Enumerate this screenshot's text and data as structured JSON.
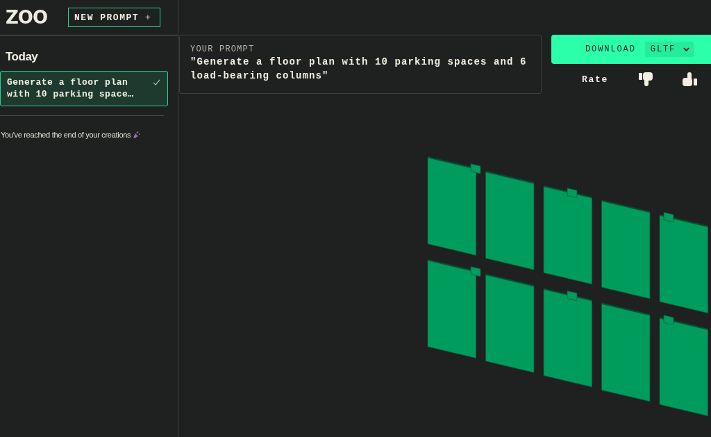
{
  "header": {
    "logo": "ZOO",
    "new_prompt_button": {
      "label": "NEW PROMPT",
      "symbol": "+"
    }
  },
  "sidebar": {
    "section_title": "Today",
    "items": [
      {
        "label": "Generate a floor plan with 10 parking space…",
        "selected": true,
        "completed": true
      }
    ],
    "end_note": "You've reached the end of your creations"
  },
  "prompt_card": {
    "label": "YOUR PROMPT",
    "text": "\"Generate a floor plan with 10 parking spaces and 6 load-bearing columns\""
  },
  "download": {
    "label": "DOWNLOAD",
    "format": "GLTF"
  },
  "rating": {
    "label": "Rate"
  }
}
